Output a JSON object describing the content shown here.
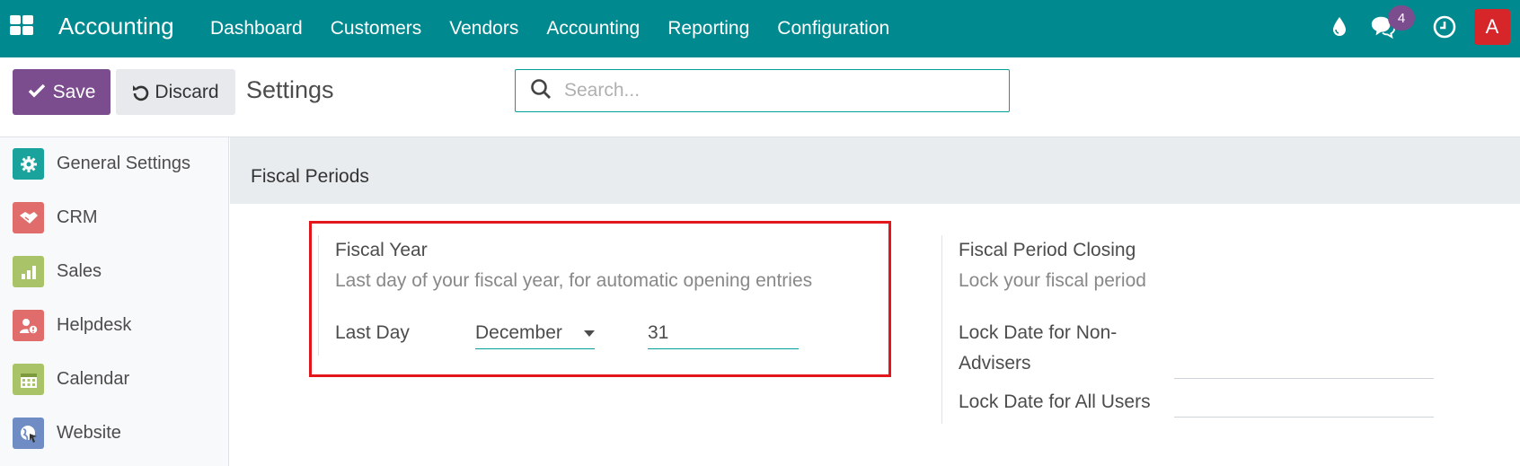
{
  "navbar": {
    "app_name": "Accounting",
    "menu": [
      "Dashboard",
      "Customers",
      "Vendors",
      "Accounting",
      "Reporting",
      "Configuration"
    ],
    "messages_badge": "4",
    "avatar_letter": "A",
    "icons": [
      "apps-grid-icon",
      "droplet-icon",
      "chat-icon",
      "clock-icon"
    ],
    "color": "#00898f"
  },
  "toolbar": {
    "save_label": "Save",
    "discard_label": "Discard",
    "title": "Settings",
    "search_placeholder": "Search..."
  },
  "sidebar": {
    "items": [
      {
        "label": "General Settings",
        "icon": "gear-icon",
        "color": "#1aa39d"
      },
      {
        "label": "CRM",
        "icon": "handshake-icon",
        "color": "#e06c6c"
      },
      {
        "label": "Sales",
        "icon": "chart-icon",
        "color": "#a9c468"
      },
      {
        "label": "Helpdesk",
        "icon": "helpdesk-icon",
        "color": "#e06c6c"
      },
      {
        "label": "Calendar",
        "icon": "calendar-icon",
        "color": "#a9c468"
      },
      {
        "label": "Website",
        "icon": "globe-icon",
        "color": "#6f8cc4"
      }
    ]
  },
  "section": {
    "title": "Fiscal Periods"
  },
  "fiscal_year": {
    "title": "Fiscal Year",
    "description": "Last day of your fiscal year, for automatic opening entries",
    "last_day_label": "Last Day",
    "month": "December",
    "day": "31"
  },
  "fiscal_period_closing": {
    "title": "Fiscal Period Closing",
    "description": "Lock your fiscal period",
    "non_advisers_label_1": "Lock Date for Non-",
    "non_advisers_label_2": "Advisers",
    "all_users_label": "Lock Date for All Users"
  }
}
